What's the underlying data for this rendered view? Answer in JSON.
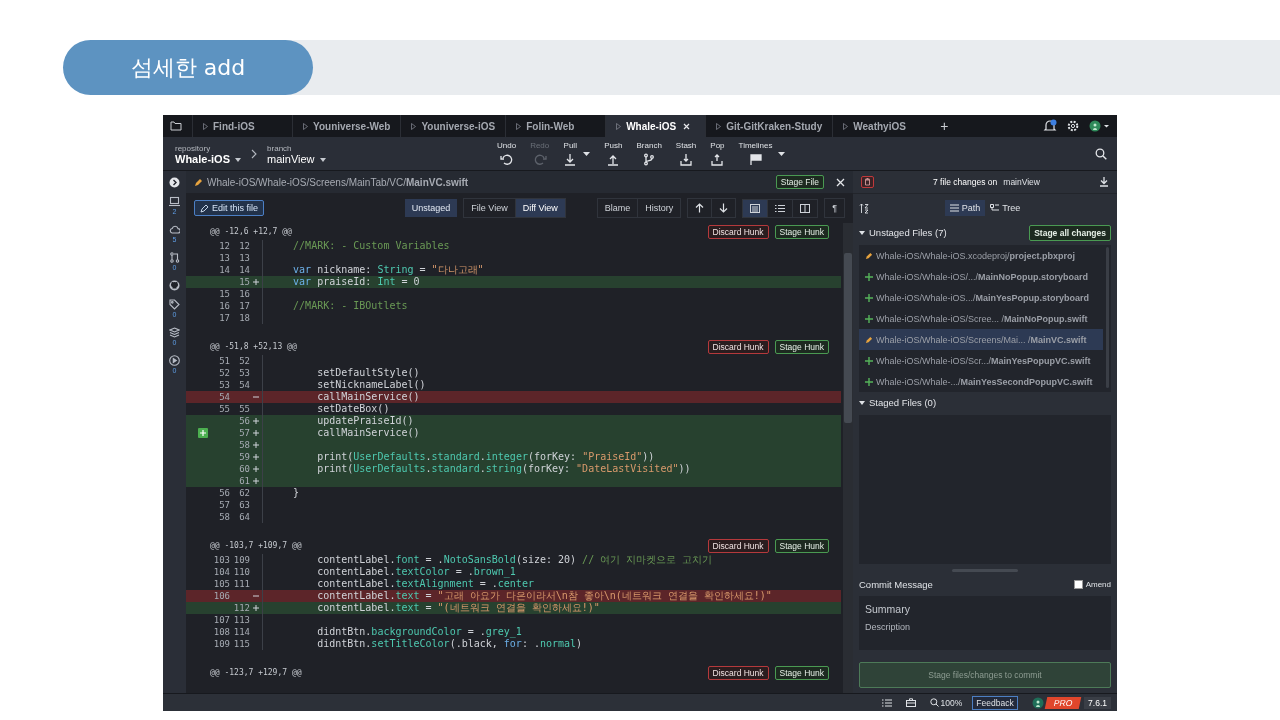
{
  "slide_title": "섬세한 add",
  "tabs": [
    {
      "label": "Find-iOS",
      "selected": false
    },
    {
      "label": "Youniverse-Web",
      "selected": false
    },
    {
      "label": "Youniverse-iOS",
      "selected": false
    },
    {
      "label": "Folin-Web",
      "selected": false
    },
    {
      "label": "Whale-iOS",
      "selected": true
    },
    {
      "label": "Git-GitKraken-Study",
      "selected": false
    },
    {
      "label": "WeathyiOS",
      "selected": false
    }
  ],
  "new_tab": "+",
  "toolbar": {
    "repository_label": "repository",
    "repository": "Whale-iOS",
    "branch_label": "branch",
    "branch": "mainView",
    "actions": [
      {
        "label": "Undo",
        "kind": "undo",
        "disabled": false,
        "dropdown": false
      },
      {
        "label": "Redo",
        "kind": "redo",
        "disabled": true,
        "dropdown": false
      },
      {
        "label": "Pull",
        "kind": "pull",
        "disabled": false,
        "dropdown": true
      },
      {
        "label": "Push",
        "kind": "push",
        "disabled": false,
        "dropdown": false
      },
      {
        "label": "Branch",
        "kind": "branch",
        "disabled": false,
        "dropdown": false
      },
      {
        "label": "Stash",
        "kind": "stash",
        "disabled": false,
        "dropdown": false
      },
      {
        "label": "Pop",
        "kind": "pop",
        "disabled": false,
        "dropdown": false
      },
      {
        "label": "Timelines",
        "kind": "timelines",
        "disabled": false,
        "dropdown": true
      }
    ]
  },
  "left_rail": [
    {
      "kind": "toggle"
    },
    {
      "kind": "local",
      "count": "2"
    },
    {
      "kind": "remote",
      "count": "5"
    },
    {
      "kind": "pull_requests",
      "count": "0"
    },
    {
      "kind": "github"
    },
    {
      "kind": "tags",
      "count": "0"
    },
    {
      "kind": "stashes",
      "count": "0"
    },
    {
      "kind": "submodules",
      "count": "0"
    }
  ],
  "diff": {
    "path": "Whale-iOS/Whale-iOS/Screens/MainTab/VC/**MainVC.swift**",
    "stage_file": "Stage File",
    "edit_button": "Edit this file",
    "status": "Unstaged",
    "views": [
      {
        "label": "File View",
        "selected": false
      },
      {
        "label": "Diff View",
        "selected": true
      }
    ],
    "history_buttons": [
      "Blame",
      "History"
    ],
    "layouts": [
      {
        "kind": "inline",
        "selected": true
      },
      {
        "kind": "list",
        "selected": false
      },
      {
        "kind": "split",
        "selected": false
      }
    ],
    "whitespace_toggle": "¶",
    "hunks": [
      {
        "header": "@@ -12,6 +12,7 @@",
        "discard": "Discard Hunk",
        "stage": "Stage Hunk",
        "lines": [
          {
            "old": "12",
            "new": "12",
            "kind": "context",
            "code": [
              {
                "kind": "comment",
                "text": "    //MARK: - Custom Variables"
              }
            ]
          },
          {
            "old": "13",
            "new": "13",
            "kind": "context"
          },
          {
            "old": "14",
            "new": "14",
            "kind": "context",
            "code": [
              {
                "kind": "keyword",
                "text": "    var"
              },
              {
                "kind": "plain",
                "text": " nickname: "
              },
              {
                "kind": "type",
                "text": "String"
              },
              {
                "kind": "plain",
                "text": " = "
              },
              {
                "kind": "string",
                "text": "\"다나고래\""
              }
            ]
          },
          {
            "new": "15",
            "kind": "add",
            "code": [
              {
                "kind": "keyword",
                "text": "    var"
              },
              {
                "kind": "plain",
                "text": " praiseId: "
              },
              {
                "kind": "type",
                "text": "Int"
              },
              {
                "kind": "plain",
                "text": " = 0"
              }
            ]
          },
          {
            "old": "15",
            "new": "16",
            "kind": "context"
          },
          {
            "old": "16",
            "new": "17",
            "kind": "context",
            "code": [
              {
                "kind": "comment",
                "text": "    //MARK: - IBOutlets"
              }
            ]
          },
          {
            "old": "17",
            "new": "18",
            "kind": "context"
          }
        ]
      },
      {
        "header": "@@ -51,8 +52,13 @@",
        "discard": "Discard Hunk",
        "stage": "Stage Hunk",
        "lines": [
          {
            "old": "51",
            "new": "52",
            "kind": "context"
          },
          {
            "old": "52",
            "new": "53",
            "kind": "context",
            "code": [
              {
                "kind": "plain",
                "text": "        setDefaultStyle()"
              }
            ]
          },
          {
            "old": "53",
            "new": "54",
            "kind": "context",
            "code": [
              {
                "kind": "plain",
                "text": "        setNicknameLabel()"
              }
            ]
          },
          {
            "old": "54",
            "kind": "del",
            "code": [
              {
                "kind": "plain",
                "text": "        callMainService()"
              }
            ]
          },
          {
            "old": "55",
            "new": "55",
            "kind": "context",
            "code": [
              {
                "kind": "plain",
                "text": "        setDateBox()"
              }
            ]
          },
          {
            "new": "56",
            "kind": "add",
            "code": [
              {
                "kind": "plain",
                "text": "        updatePraiseId()"
              }
            ]
          },
          {
            "new": "57",
            "kind": "add",
            "hover_stage": true,
            "code": [
              {
                "kind": "plain",
                "text": "        callMainService()"
              }
            ]
          },
          {
            "new": "58",
            "kind": "add"
          },
          {
            "new": "59",
            "kind": "add",
            "code": [
              {
                "kind": "plain",
                "text": "        print("
              },
              {
                "kind": "type",
                "text": "UserDefaults"
              },
              {
                "kind": "plain",
                "text": "."
              },
              {
                "kind": "member",
                "text": "standard"
              },
              {
                "kind": "plain",
                "text": "."
              },
              {
                "kind": "member",
                "text": "integer"
              },
              {
                "kind": "plain",
                "text": "(forKey: "
              },
              {
                "kind": "string",
                "text": "\"PraiseId\""
              },
              {
                "kind": "plain",
                "text": "))"
              }
            ]
          },
          {
            "new": "60",
            "kind": "add",
            "code": [
              {
                "kind": "plain",
                "text": "        print("
              },
              {
                "kind": "type",
                "text": "UserDefaults"
              },
              {
                "kind": "plain",
                "text": "."
              },
              {
                "kind": "member",
                "text": "standard"
              },
              {
                "kind": "plain",
                "text": "."
              },
              {
                "kind": "member",
                "text": "string"
              },
              {
                "kind": "plain",
                "text": "(forKey: "
              },
              {
                "kind": "string",
                "text": "\"DateLastVisited\""
              },
              {
                "kind": "plain",
                "text": "))"
              }
            ]
          },
          {
            "new": "61",
            "kind": "add"
          },
          {
            "old": "56",
            "new": "62",
            "kind": "context",
            "code": [
              {
                "kind": "plain",
                "text": "    }"
              }
            ]
          },
          {
            "old": "57",
            "new": "63",
            "kind": "context"
          },
          {
            "old": "58",
            "new": "64",
            "kind": "context"
          }
        ]
      },
      {
        "header": "@@ -103,7 +109,7 @@",
        "discard": "Discard Hunk",
        "stage": "Stage Hunk",
        "lines": [
          {
            "old": "103",
            "new": "109",
            "kind": "context",
            "code": [
              {
                "kind": "plain",
                "text": "        contentLabel."
              },
              {
                "kind": "member",
                "text": "font"
              },
              {
                "kind": "plain",
                "text": " = ."
              },
              {
                "kind": "member",
                "text": "NotoSansBold"
              },
              {
                "kind": "plain",
                "text": "(size: 20) "
              },
              {
                "kind": "comment",
                "text": "// 여기 지마켓으로 고치기"
              }
            ]
          },
          {
            "old": "104",
            "new": "110",
            "kind": "context",
            "code": [
              {
                "kind": "plain",
                "text": "        contentLabel."
              },
              {
                "kind": "member",
                "text": "textColor"
              },
              {
                "kind": "plain",
                "text": " = ."
              },
              {
                "kind": "member",
                "text": "brown_1"
              }
            ]
          },
          {
            "old": "105",
            "new": "111",
            "kind": "context",
            "code": [
              {
                "kind": "plain",
                "text": "        contentLabel."
              },
              {
                "kind": "member",
                "text": "textAlignment"
              },
              {
                "kind": "plain",
                "text": " = ."
              },
              {
                "kind": "member",
                "text": "center"
              }
            ]
          },
          {
            "old": "106",
            "kind": "del",
            "code": [
              {
                "kind": "plain",
                "text": "        contentLabel."
              },
              {
                "kind": "member",
                "text": "text"
              },
              {
                "kind": "plain",
                "text": " = "
              },
              {
                "kind": "string",
                "text": "\"고래 아요가 다은이라서\\n참 좋아\\n(네트워크 연결을 확인하세요!)\""
              }
            ]
          },
          {
            "new": "112",
            "kind": "add",
            "code": [
              {
                "kind": "plain",
                "text": "        contentLabel."
              },
              {
                "kind": "member",
                "text": "text"
              },
              {
                "kind": "plain",
                "text": " = "
              },
              {
                "kind": "string",
                "text": "\"(네트워크 연결을 확인하세요!)\""
              }
            ]
          },
          {
            "old": "107",
            "new": "113",
            "kind": "context"
          },
          {
            "old": "108",
            "new": "114",
            "kind": "context",
            "code": [
              {
                "kind": "plain",
                "text": "        didntBtn."
              },
              {
                "kind": "member",
                "text": "backgroundColor"
              },
              {
                "kind": "plain",
                "text": " = ."
              },
              {
                "kind": "member",
                "text": "grey_1"
              }
            ]
          },
          {
            "old": "109",
            "new": "115",
            "kind": "context",
            "code": [
              {
                "kind": "plain",
                "text": "        didntBtn."
              },
              {
                "kind": "member",
                "text": "setTitleColor"
              },
              {
                "kind": "plain",
                "text": "(.black, "
              },
              {
                "kind": "keyword",
                "text": "for"
              },
              {
                "kind": "plain",
                "text": ": ."
              },
              {
                "kind": "member",
                "text": "normal"
              },
              {
                "kind": "plain",
                "text": ")"
              }
            ]
          }
        ]
      },
      {
        "header": "@@ -123,7 +129,7 @@",
        "discard": "Discard Hunk",
        "stage": "Stage Hunk"
      }
    ]
  },
  "changes": {
    "summary": "7 file changes on",
    "branch": "mainView",
    "views": [
      {
        "label": "Path",
        "kind": "path",
        "selected": true
      },
      {
        "label": "Tree",
        "kind": "tree",
        "selected": false
      }
    ],
    "unstaged_title": "Unstaged Files (7)",
    "unstaged_expanded": true,
    "stage_all": "Stage all changes",
    "unstaged": [
      {
        "kind": "modified",
        "path": "Whale-iOS/Whale-iOS.xcodeproj/**project.pbxproj**",
        "selected": false
      },
      {
        "kind": "added",
        "path": "Whale-iOS/Whale-iOS/.../**MainNoPopup.storyboard**",
        "selected": false
      },
      {
        "kind": "added",
        "path": "Whale-iOS/Whale-iOS.../**MainYesPopup.storyboard**",
        "selected": false
      },
      {
        "kind": "added",
        "path": "Whale-iOS/Whale-iOS/Scree... /**MainNoPopup.swift**",
        "selected": false
      },
      {
        "kind": "modified",
        "path": "Whale-iOS/Whale-iOS/Screens/Mai... /**MainVC.swift**",
        "selected": true
      },
      {
        "kind": "added",
        "path": "Whale-iOS/Whale-iOS/Scr.../**MainYesPopupVC.swift**",
        "selected": false
      },
      {
        "kind": "added",
        "path": "Whale-iOS/Whale-.../**MainYesSecondPopupVC.swift**",
        "selected": false
      }
    ],
    "staged_title": "Staged Files (0)",
    "staged_expanded": true,
    "commit_title": "Commit Message",
    "amend": {
      "label": "Amend",
      "checked": false
    },
    "summary_placeholder": "Summary",
    "description_placeholder": "Description",
    "commit_button": {
      "label": "Stage files/changes to commit",
      "disabled": true
    }
  },
  "status_bar": {
    "zoom": "100%",
    "feedback": "Feedback",
    "plan": "PRO",
    "version": "7.6.1"
  }
}
